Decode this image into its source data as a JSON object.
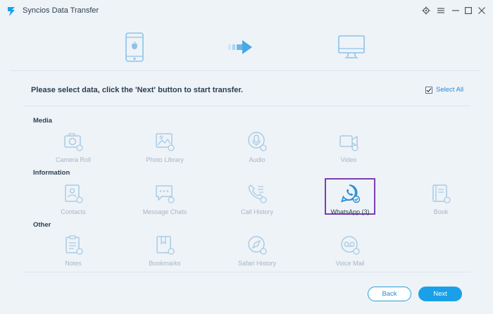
{
  "window": {
    "title": "Syncios Data Transfer",
    "controls": [
      "gear-icon",
      "menu-icon",
      "minimize-icon",
      "maximize-icon",
      "close-icon"
    ]
  },
  "banner": {
    "source_device": "phone-icon",
    "direction": "arrow-right-icon",
    "target_device": "monitor-icon"
  },
  "instruction": "Please select data, click the 'Next' button to start transfer.",
  "select_all": {
    "label": "Select All",
    "checked": true
  },
  "sections": {
    "media": {
      "label": "Media",
      "items": [
        "Camera Roll",
        "Photo Library",
        "Audio",
        "Video"
      ]
    },
    "information": {
      "label": "Information",
      "items": [
        "Contacts",
        "Message Chats",
        "Call History",
        "WhatsApp (3)",
        "Book"
      ]
    },
    "other": {
      "label": "Other",
      "items": [
        "Notes",
        "Bookmarks",
        "Safari History",
        "Voice Mail"
      ]
    }
  },
  "buttons": {
    "back": "Back",
    "next": "Next"
  },
  "colors": {
    "accent": "#1aa0e8",
    "inactive_icon": "#a9cbe3",
    "active_icon": "#2d8fd5",
    "highlight_border": "#7b3fb1",
    "background": "#eef3f8"
  }
}
